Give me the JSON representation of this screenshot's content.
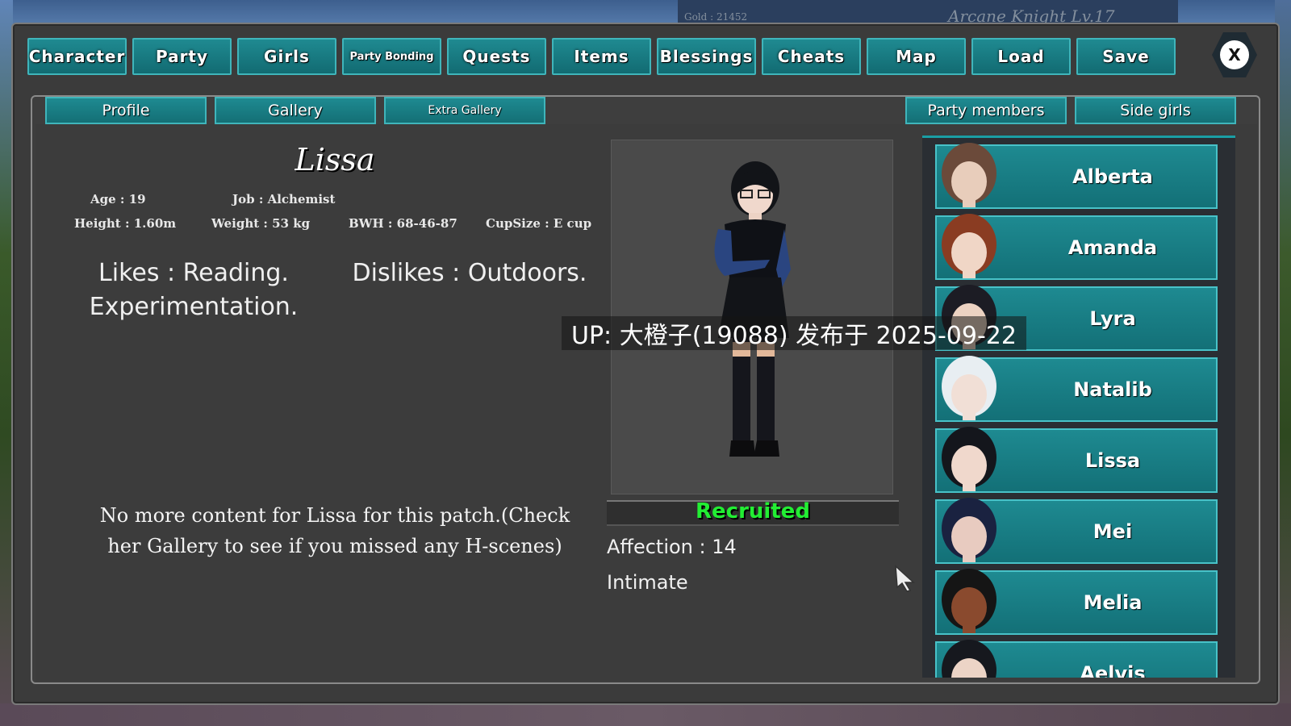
{
  "hud": {
    "gold": "Gold : 21452",
    "player": "Arcane Knight Lv.17"
  },
  "tabs": [
    "Character",
    "Party",
    "Girls",
    "Party Bonding",
    "Quests",
    "Items",
    "Blessings",
    "Cheats",
    "Map",
    "Load",
    "Save"
  ],
  "close_label": "X",
  "subtabs_left": [
    "Profile",
    "Gallery",
    "Extra Gallery"
  ],
  "subtabs_right": [
    "Party members",
    "Side girls"
  ],
  "profile": {
    "name": "Lissa",
    "age": "Age : 19",
    "job": "Job : Alchemist",
    "height": "Height : 1.60m",
    "weight": "Weight : 53 kg",
    "bwh": "BWH : 68-46-87",
    "cup": "CupSize : E cup",
    "likes": "Likes : Reading. Experimentation.",
    "dislikes": "Dislikes : Outdoors.",
    "message": "No more content for Lissa for this patch.(Check her Gallery to see if you missed any H-scenes)",
    "status": "Recruited",
    "affection": "Affection : 14",
    "intimacy": "Intimate"
  },
  "girls": [
    {
      "name": "Alberta",
      "hair": "#6b4a3a",
      "skin": "#e8cdbb"
    },
    {
      "name": "Amanda",
      "hair": "#8a3c22",
      "skin": "#f0d6c6"
    },
    {
      "name": "Lyra",
      "hair": "#1c1c24",
      "skin": "#ecd2c2"
    },
    {
      "name": "Natalib",
      "hair": "#e8eef2",
      "skin": "#f1dfd6"
    },
    {
      "name": "Lissa",
      "hair": "#14161c",
      "skin": "#f0d8cc"
    },
    {
      "name": "Mei",
      "hair": "#1a2240",
      "skin": "#e8cbc0"
    },
    {
      "name": "Melia",
      "hair": "#151515",
      "skin": "#8a4a2e"
    },
    {
      "name": "Aelvis",
      "hair": "#16181e",
      "skin": "#ecd4c6"
    }
  ],
  "watermark": "UP: 大橙子(19088) 发布于 2025-09-22",
  "colors": {
    "teal": "#1e8a91",
    "recruited": "#22ee33"
  }
}
